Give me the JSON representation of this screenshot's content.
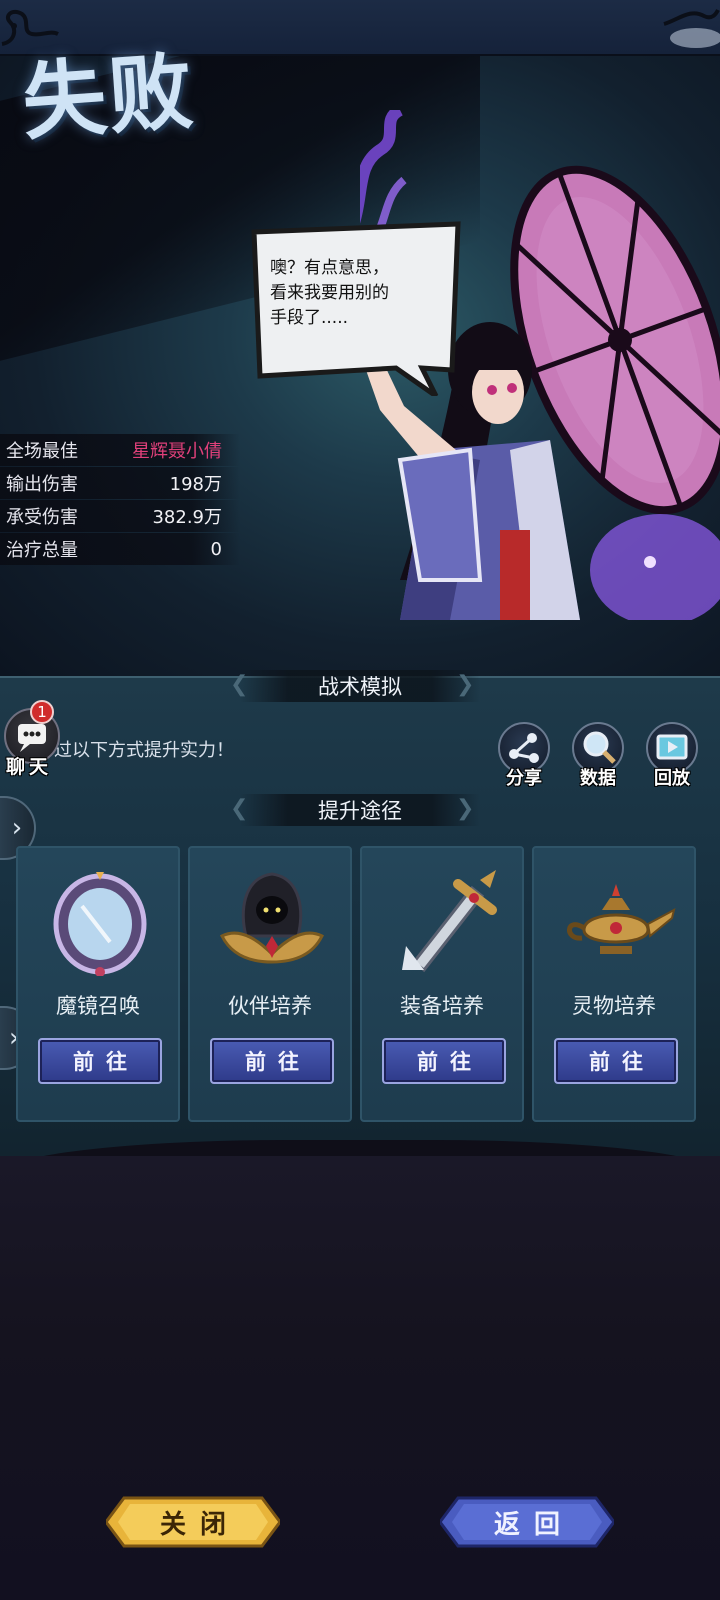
{
  "result": {
    "title": "失败"
  },
  "speech_bubble": {
    "text_lines": [
      "噢？有点意思，",
      "看来我要用别的",
      "手段了....."
    ]
  },
  "stats": [
    {
      "label": "全场最佳",
      "value": "星辉聂小倩",
      "highlight": true
    },
    {
      "label": "输出伤害",
      "value": "198万",
      "highlight": false
    },
    {
      "label": "承受伤害",
      "value": "382.9万",
      "highlight": false
    },
    {
      "label": "治疗总量",
      "value": "0",
      "highlight": false
    }
  ],
  "panel": {
    "section_title": "战术模拟",
    "tip": "过以下方式提升实力！",
    "improve_title": "提升途径"
  },
  "chat": {
    "label": "聊天",
    "badge": "1"
  },
  "actions": {
    "share": "分享",
    "data": "数据",
    "replay": "回放"
  },
  "side_tabs": {
    "top": "›",
    "bottom": "»"
  },
  "cards": [
    {
      "name": "魔镜召唤",
      "icon": "magic-mirror-icon",
      "button": "前往"
    },
    {
      "name": "伙伴培养",
      "icon": "hooded-partner-icon",
      "button": "前往"
    },
    {
      "name": "装备培养",
      "icon": "sword-icon",
      "button": "前往"
    },
    {
      "name": "灵物培养",
      "icon": "magic-lamp-icon",
      "button": "前往"
    }
  ],
  "buttons": {
    "close": "关闭",
    "back": "返回"
  },
  "colors": {
    "highlight": "#e0407a",
    "go_button": "#3a4aa0",
    "close_button": "#e8b43a",
    "back_button": "#4a5cc0"
  }
}
